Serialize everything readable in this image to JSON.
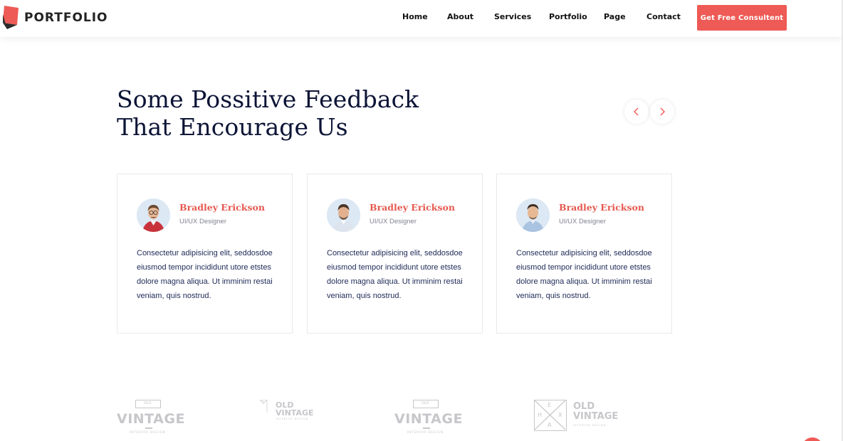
{
  "header": {
    "logo_text": "PORTFOLIO",
    "nav": [
      {
        "label": "Home"
      },
      {
        "label": "About"
      },
      {
        "label": "Services"
      },
      {
        "label": "Portfolio"
      },
      {
        "label": "Page"
      },
      {
        "label": "Contact"
      }
    ],
    "cta_label": "Get Free Consultent"
  },
  "section": {
    "title_line1": "Some Possitive Feedback",
    "title_line2": "That Encourage Us",
    "prev_icon": "chevron-left-icon",
    "next_icon": "chevron-right-icon"
  },
  "testimonials": [
    {
      "name": "Bradley Erickson",
      "role": "UI/UX Designer",
      "text": "Consectetur adipisicing elit, seddosdoe eiusmod tempor incididunt utore etstes dolore magna aliqua. Ut imminim restai veniam, quis nostrud."
    },
    {
      "name": "Bradley Erickson",
      "role": "UI/UX Designer",
      "text": "Consectetur adipisicing elit, seddosdoe eiusmod tempor incididunt utore etstes dolore magna aliqua. Ut imminim restai veniam, quis nostrud."
    },
    {
      "name": "Bradley Erickson",
      "role": "UI/UX Designer",
      "text": "Consectetur adipisicing elit, seddosdoe eiusmod tempor incididunt utore etstes dolore magna aliqua. Ut imminim restai veniam, quis nostrud."
    }
  ],
  "brands": [
    {
      "small": "OLD",
      "word": "VINTAGE",
      "sub": "INTERIOR DESIGN"
    },
    {
      "word1": "OLD",
      "word2": "VINTAGE",
      "sub": "INTERIOR DESIGN"
    },
    {
      "small": "OLD",
      "word": "VINTAGE",
      "sub": "INTERIOR DESIGN"
    },
    {
      "word1": "OLD",
      "word2": "VINTAGE",
      "sub": "INTERIOR DESIGN",
      "letters": [
        "E",
        "H",
        "X",
        "A"
      ]
    }
  ],
  "colors": {
    "accent": "#ee5a55",
    "heading": "#0c1436",
    "name": "#e6584f"
  }
}
